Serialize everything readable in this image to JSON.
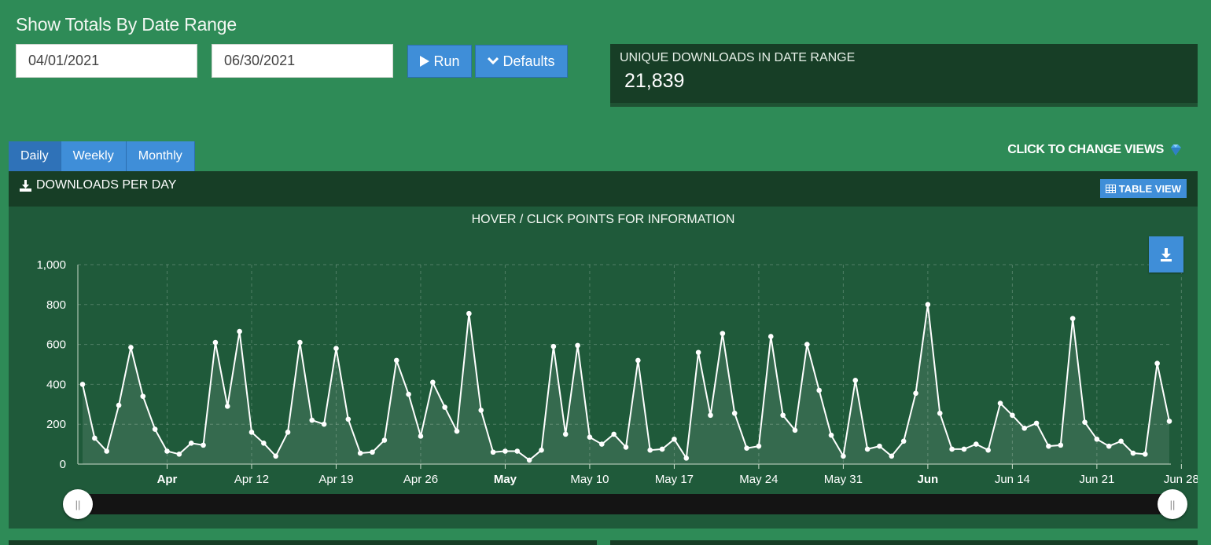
{
  "header": {
    "title": "Show Totals By Date Range"
  },
  "form": {
    "start_date": "04/01/2021",
    "end_date": "06/30/2021",
    "run_label": "Run",
    "defaults_label": "Defaults"
  },
  "stat": {
    "label": "UNIQUE DOWNLOADS IN DATE RANGE",
    "value": "21,839"
  },
  "tabs": [
    {
      "label": "Daily",
      "active": true
    },
    {
      "label": "Weekly",
      "active": false
    },
    {
      "label": "Monthly",
      "active": false
    }
  ],
  "change_views": "CLICK TO CHANGE VIEWS",
  "panel": {
    "title": "DOWNLOADS PER DAY",
    "table_view_label": "TABLE VIEW",
    "hint": "HOVER / CLICK POINTS FOR INFORMATION"
  },
  "icons": {
    "run": "play-icon",
    "defaults": "chevron-down-icon",
    "panel_title": "download-icon",
    "table_view": "table-icon",
    "export": "download-icon",
    "change_views": "gem-icon"
  },
  "colors": {
    "page_bg": "#2e8b57",
    "dark_panel": "#173e26",
    "chart_bg": "#1f5a3a",
    "accent_blue": "#3f8ed8",
    "line": "#ffffff"
  },
  "chart_data": {
    "type": "area",
    "x_start": "2021-03-29",
    "yticks": [
      "0",
      "200",
      "400",
      "600",
      "800",
      "1,000"
    ],
    "ylim": [
      0,
      1000
    ],
    "xticks": [
      {
        "label": "Apr",
        "date": "2021-04-05",
        "bold": true
      },
      {
        "label": "Apr 12",
        "date": "2021-04-12",
        "bold": false
      },
      {
        "label": "Apr 19",
        "date": "2021-04-19",
        "bold": false
      },
      {
        "label": "Apr 26",
        "date": "2021-04-26",
        "bold": false
      },
      {
        "label": "May",
        "date": "2021-05-03",
        "bold": true
      },
      {
        "label": "May 10",
        "date": "2021-05-10",
        "bold": false
      },
      {
        "label": "May 17",
        "date": "2021-05-17",
        "bold": false
      },
      {
        "label": "May 24",
        "date": "2021-05-24",
        "bold": false
      },
      {
        "label": "May 31",
        "date": "2021-05-31",
        "bold": false
      },
      {
        "label": "Jun",
        "date": "2021-06-07",
        "bold": true
      },
      {
        "label": "Jun 14",
        "date": "2021-06-14",
        "bold": false
      },
      {
        "label": "Jun 21",
        "date": "2021-06-21",
        "bold": false
      },
      {
        "label": "Jun 28",
        "date": "2021-06-28",
        "bold": false
      }
    ],
    "values": [
      400,
      130,
      65,
      295,
      585,
      340,
      175,
      65,
      50,
      105,
      95,
      610,
      290,
      665,
      160,
      105,
      40,
      160,
      610,
      220,
      200,
      580,
      225,
      55,
      60,
      120,
      520,
      350,
      140,
      410,
      285,
      165,
      755,
      270,
      60,
      65,
      65,
      20,
      70,
      590,
      150,
      595,
      135,
      100,
      150,
      85,
      520,
      70,
      75,
      125,
      30,
      560,
      245,
      655,
      255,
      80,
      90,
      640,
      245,
      170,
      600,
      370,
      145,
      40,
      420,
      75,
      90,
      40,
      115,
      355,
      800,
      255,
      75,
      75,
      100,
      70,
      305,
      245,
      180,
      205,
      90,
      95,
      730,
      210,
      125,
      90,
      115,
      55,
      50,
      505,
      215
    ],
    "grid": true,
    "navigator": true
  }
}
